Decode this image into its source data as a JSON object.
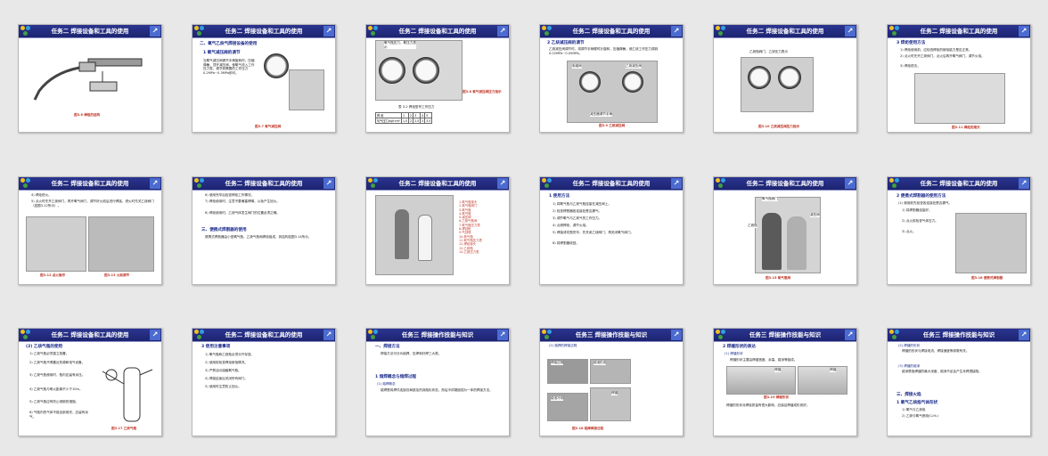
{
  "header_titles": {
    "task2": "任务二  焊接设备和工具的使用",
    "task3": "任务三  焊接操作技能与知识"
  },
  "icons": {
    "logo": "logo-icon",
    "corner": "link-icon"
  },
  "colors": {
    "header": "#1d2470",
    "caption": "#c0392b",
    "heading": "#1a2a8a"
  },
  "slides": {
    "s1": {
      "cap": "图3.6 焊炬的结构"
    },
    "s2": {
      "h1": "二、氧气乙炔气焊接设备的使用",
      "h2": "1 氧气减压阀的调节",
      "body": "当氧气减压阀调节手柄旋转时，压缩弹簧，顶开减压阀，使氧气流入工作压力表，调节到需要的工作压力0.2MPa~0.3MPa即可。",
      "cap": "图3.7 氧气减压阀"
    },
    "s3": {
      "label": "氧气瓶压力，氧压力表示",
      "cap": "图3.8 氧气减压阀压力指示",
      "table_title": "表 3-2  焊炬型号工作压力",
      "row1": [
        "焊  炬",
        "1",
        "2",
        "3",
        "4",
        "5"
      ],
      "row2": [
        "氧气压力/kgf·cm²",
        "1.5",
        "2",
        "2.5",
        "3",
        "3.5"
      ]
    },
    "s4": {
      "h1": "2 乙炔减压阀的调节",
      "body": "乙炔减压阀调节时，将调节手柄顺时针旋转，压缩弹簧，使乙炔工作压力调到0.02MPa~0.05MPa。",
      "label1": "电磁阀",
      "label2": "乙炔减压阀",
      "label3": "减压器调节手柄",
      "cap": "图3.9 乙炔减压阀"
    },
    "s5": {
      "label": "乙炔瓶阀门，乙炔压力表示",
      "cap": "图3.10 乙炔减压阀压力指示"
    },
    "s6": {
      "h1": "3 焊炬使用方法",
      "items": [
        "1) 焊炬使用前，应检查焊炬的射吸能力是否正常。",
        "2) 点火时先开乙炔阀门，点火后再开氧气阀门，调节火焰。",
        "3) 焊炬熄灭。"
      ],
      "cap": "图3.11 焊炬的熄灭"
    },
    "s7": {
      "items": [
        "4) 焊炬熄火。",
        "5) 点火时先开乙炔阀门，再开氧气阀门，调节好火焰后进行焊接，熄火时先关乙炔阀门（如图3.12所示）。"
      ],
      "cap1": "图3.12 点火操作",
      "cap2": "图3.13 火焰调节"
    },
    "s8": {
      "items": [
        "6) 使用完毕后检查焊炬工作情况。",
        "7) 焊炬使用时，注意不要堵塞焊嘴，以免产生回火。",
        "8) 焊炬使用时，乙炔气体发生阀门的位置必须正确。"
      ],
      "h1": "三、便携式焊割器的使用",
      "body": "便携式焊割器由小型氧气瓶、乙炔气瓶和焊炬组成，其结构如图3.14所示。"
    },
    "s9": {
      "list": [
        "1-氧气瓶接头",
        "2-氧气瓶阀门",
        "3-氧气瓶",
        "4-氧气瓶",
        "5-减压阀",
        "6-乙炔气瓶阀",
        "7-氧气瓶压力表",
        "8-焊割枪",
        "9-气割嘴",
        "10-氧气瓶",
        "11-氧气瓶压力表",
        "12-焊炬接头",
        "13-乙炔瓶",
        "14-乙炔压力表"
      ]
    },
    "s10": {
      "h1": "1 使用方法",
      "items": [
        "1) 将氧气瓶与乙炔气瓶连接在减压阀上。",
        "2) 检查焊割器各连接处是否漏气。",
        "3) 调节氧气与乙炔气的工作压力。",
        "4) 点燃焊炬，调节火焰。",
        "5) 焊接或切割完毕，先关闭乙炔阀门，再关闭氧气阀门。",
        "6) 将焊割器收回。"
      ]
    },
    "s11": {
      "label1": "氧气瓶阀门",
      "label2": "乙炔瓶",
      "label3": "减压阀",
      "cap": "图3.15 氧气瓶阀"
    },
    "s12": {
      "h1": "2 便携式焊割器的使用方法",
      "items": [
        "(1) 使用前先检查各连接处是否漏气。",
        "1) 将焊割器连接好。",
        "2) 点火前检查气体压力。",
        "3) 点火。"
      ],
      "cap": "图3.16 便携式焊割器"
    },
    "s13": {
      "h1": "(2) 乙炔气瓶的使用",
      "items": [
        "1) 乙炔气瓶必须直立放置。",
        "2) 乙炔气瓶不得靠近热源和电气设备。",
        "3) 乙炔气瓶使用时，瓶内应留有余压。",
        "4) 乙炔气瓶与明火距离不少于10m。",
        "5) 乙炔气瓶应有防止倾倒的措施。",
        "6) 气瓶内的气体不能全部用完，应留有余气。"
      ],
      "cap": "图3.17 乙炔气瓶"
    },
    "s14": {
      "h1": "3 使用注意事项",
      "items": [
        "1) 氧气瓶和乙炔瓶必须分开存放。",
        "2) 使用前检查焊炬射吸情况。",
        "3) 严禁油污接触氧气瓶。",
        "4) 焊接结束后关闭所有阀门。",
        "5) 使用时注意防止回火。"
      ]
    },
    "s15": {
      "h1": "一、焊接方法",
      "body": "焊接方法可分为熔焊、压焊和钎焊三大类。",
      "h2": "1 熔焊概念与熔焊过程",
      "h3": "(1) 熔焊概念",
      "body2": "熔焊是将焊件连接处局部加热到熔化状态，然后冷却凝固成为一体的焊接方法。"
    },
    "s16": {
      "h1": "(2) 熔焊的焊接过程",
      "labels": [
        "焊接过程",
        "熔池形成",
        "焊缝",
        "熔池冷却"
      ],
      "cap": "图3.18 熔焊焊接过程"
    },
    "s17": {
      "h1": "2 焊缝形状的表达",
      "h2": "(1) 焊缝形状",
      "body": "焊缝形状主要由焊缝宽度、余高、熔深等组成。",
      "label1": "焊缝",
      "label2": "焊缝",
      "cap": "图3.19 焊缝形状",
      "body2": "焊缝的形状对焊接质量有很大影响，应保证焊缝成形良好。"
    },
    "s18": {
      "items": [
        "(2) 焊缝的形状",
        "焊缝的形状与焊接电流、焊接速度等参数有关。",
        "(3) 焊缝的熔深",
        "熔深是指焊缝的最大深度，熔深不足会产生未焊透缺陷。"
      ],
      "h1": "三、焊接火焰",
      "h2": "1 氧气乙炔焰气体形状",
      "sub": [
        "1) 氧气与乙炔焰",
        "2) 乙炔与氧气燃烧(C₂H₂)"
      ]
    }
  }
}
